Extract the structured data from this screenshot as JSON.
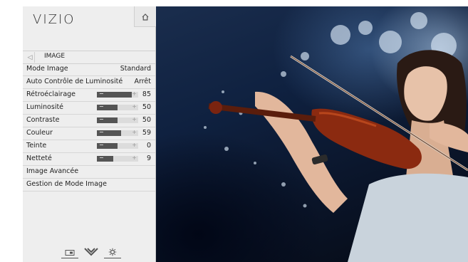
{
  "brand": "VIZIO",
  "icons": {
    "home": "home-icon",
    "back": "chevron-left-icon",
    "picture_size": "picture-size-icon",
    "wide": "wide-mode-icon",
    "settings": "gear-icon"
  },
  "menu": {
    "title": "IMAGE",
    "items": [
      {
        "label": "Mode Image",
        "value": "Standard"
      },
      {
        "label": "Auto Contrôle de Luminosité",
        "value": "Arrêt"
      },
      {
        "label": "Rétroéclairage",
        "level": 85,
        "value": "85"
      },
      {
        "label": "Luminosité",
        "level": 50,
        "value": "50"
      },
      {
        "label": "Contraste",
        "level": 50,
        "value": "50"
      },
      {
        "label": "Couleur",
        "level": 59,
        "value": "59"
      },
      {
        "label": "Teinte",
        "level": 50,
        "value": "0"
      },
      {
        "label": "Netteté",
        "level": 40,
        "value": "9"
      },
      {
        "label": "Image Avancée"
      },
      {
        "label": "Gestion de Mode Image"
      }
    ]
  }
}
